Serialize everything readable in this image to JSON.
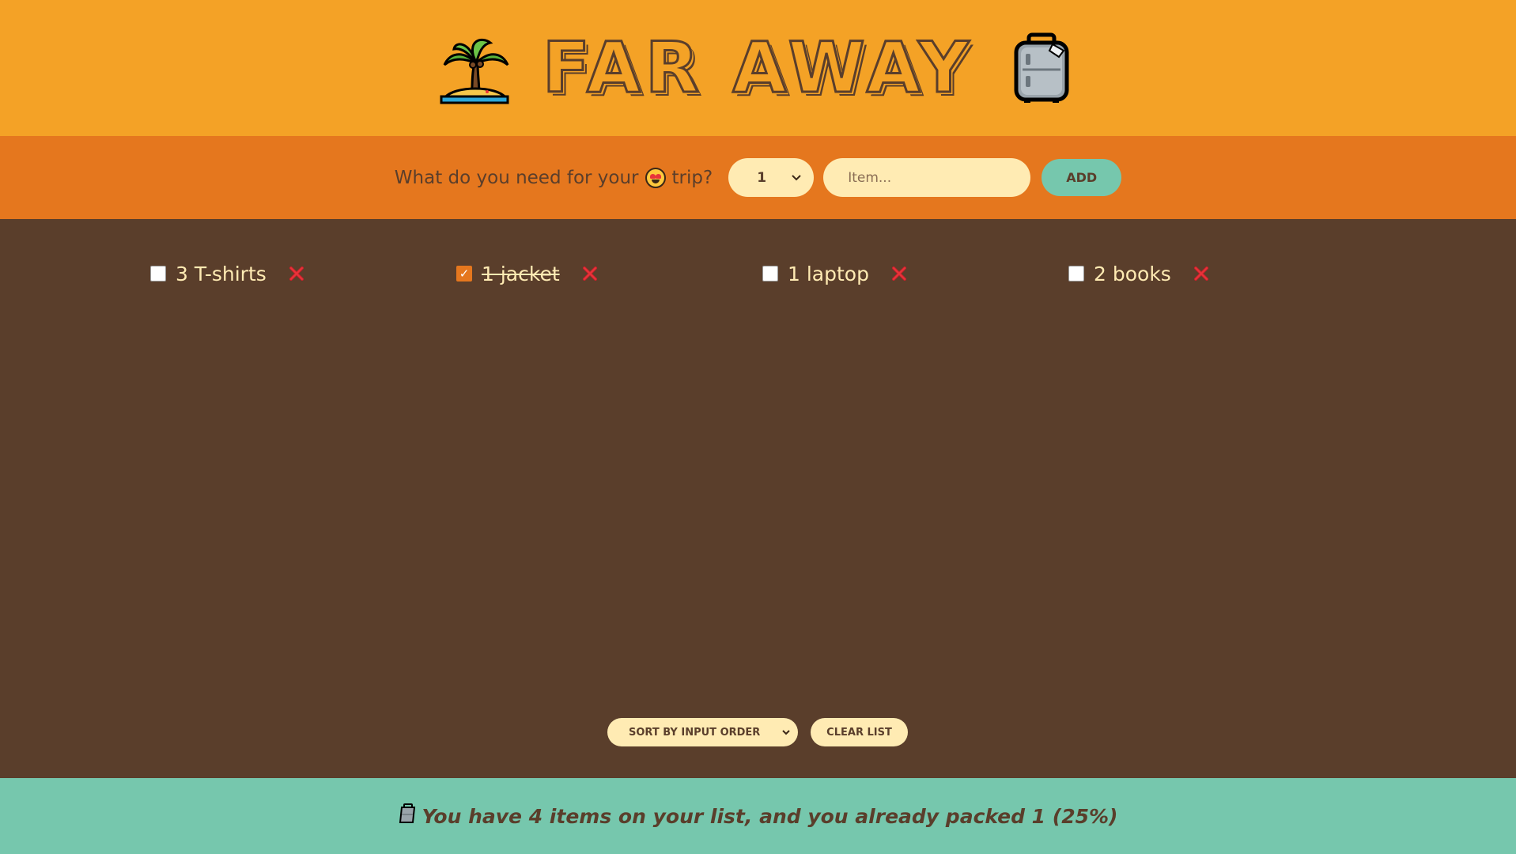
{
  "header": {
    "title": "FAR AWAY",
    "left_icon": "palm-island-icon",
    "right_icon": "luggage-icon"
  },
  "form": {
    "question_prefix": "What do you need for your",
    "question_suffix": "trip?",
    "emoji_icon": "star-struck-face-icon",
    "quantity_selected": "1",
    "item_placeholder": "Item...",
    "add_label": "ADD"
  },
  "items": [
    {
      "label": "3 T-shirts",
      "packed": false
    },
    {
      "label": "1 jacket",
      "packed": true
    },
    {
      "label": "1 laptop",
      "packed": false
    },
    {
      "label": "2 books",
      "packed": false
    }
  ],
  "actions": {
    "sort_selected": "SORT BY INPUT ORDER",
    "clear_label": "CLEAR LIST"
  },
  "stats": {
    "icon": "luggage-icon",
    "text": "You have 4 items on your list, and you already packed 1 (25%)"
  },
  "colors": {
    "header_bg": "#f4a226",
    "form_bg": "#e5771e",
    "list_bg": "#5a3e2b",
    "footer_bg": "#76c7ad",
    "cream": "#ffebb3"
  }
}
